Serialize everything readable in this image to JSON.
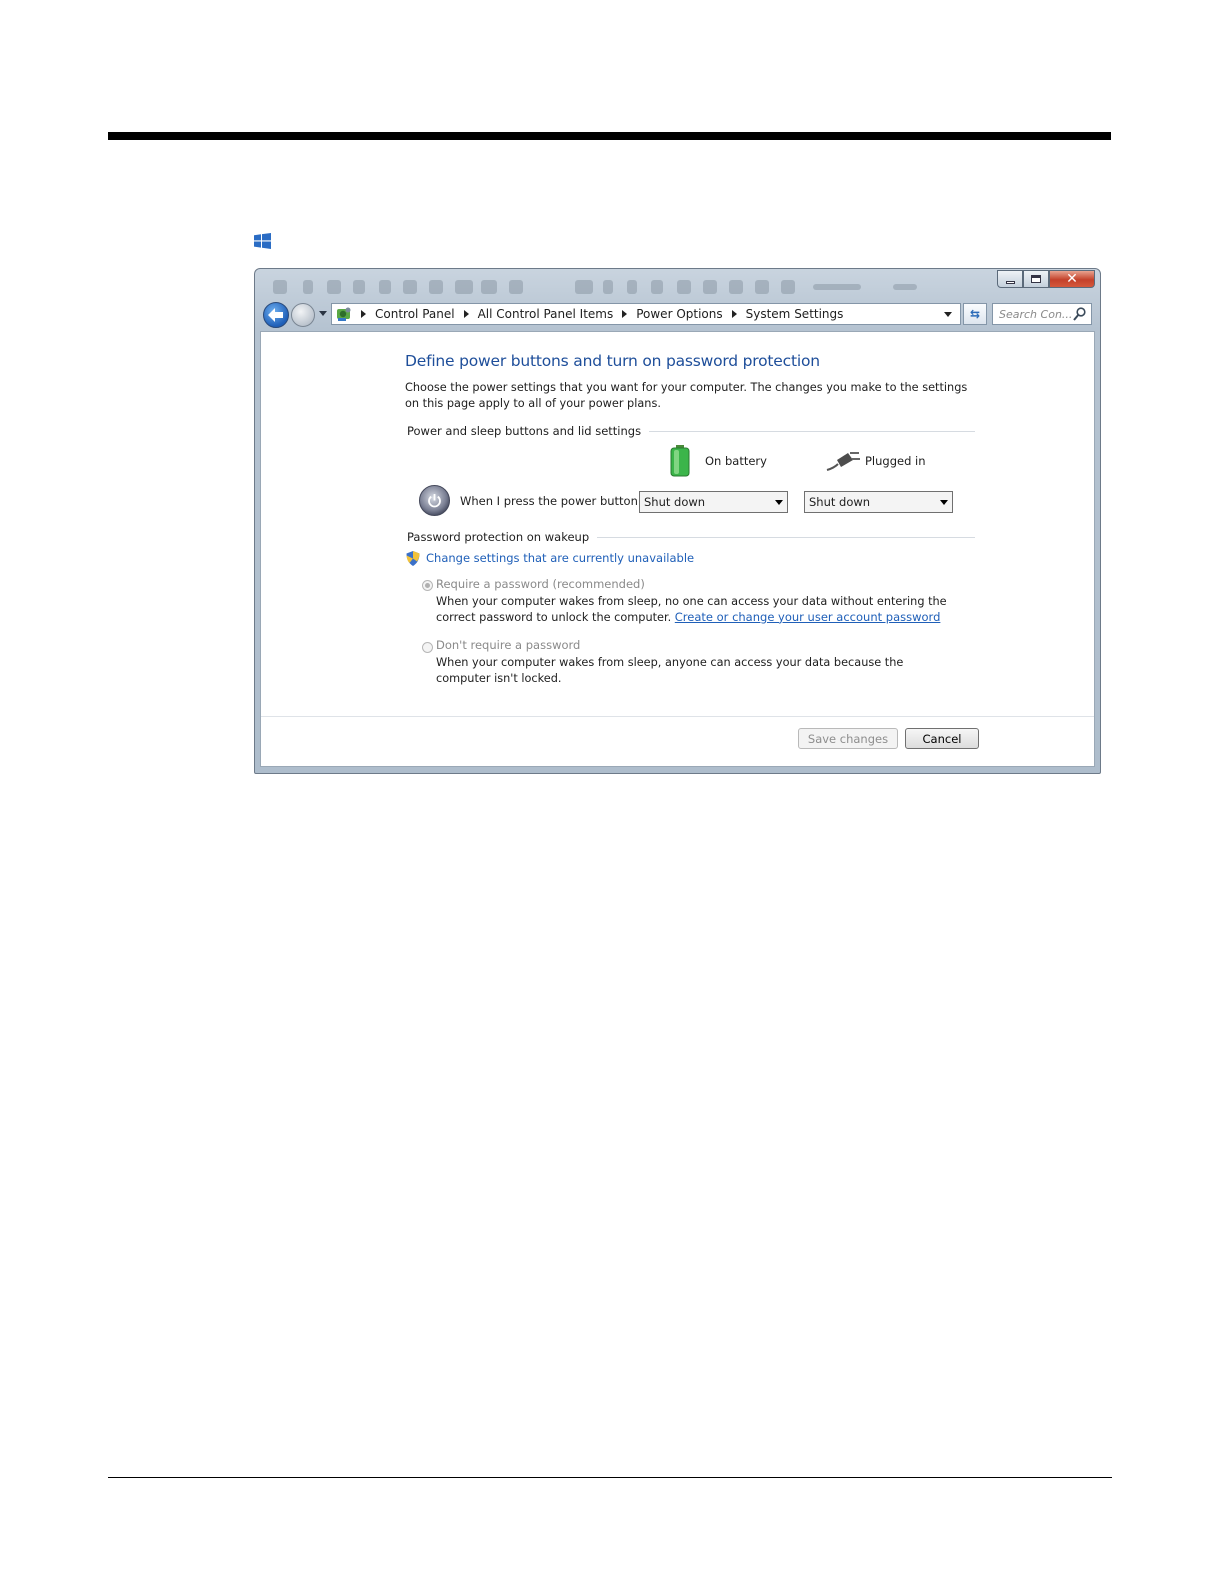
{
  "window": {
    "address": {
      "breadcrumbs": [
        "Control Panel",
        "All Control Panel Items",
        "Power Options",
        "System Settings"
      ]
    },
    "search": {
      "placeholder": "Search Con..."
    }
  },
  "page": {
    "title": "Define power buttons and turn on password protection",
    "description": "Choose the power settings that you want for your computer. The changes you make to the settings on this page apply to all of your power plans.",
    "buttons_section": {
      "heading": "Power and sleep buttons and lid settings",
      "on_battery_label": "On battery",
      "plugged_in_label": "Plugged in",
      "power_button_label": "When I press the power button:",
      "on_battery_value": "Shut down",
      "plugged_in_value": "Shut down"
    },
    "password_section": {
      "heading": "Password protection on wakeup",
      "change_link": "Change settings that are currently unavailable",
      "require": {
        "label": "Require a password (recommended)",
        "description": "When your computer wakes from sleep, no one can access your data without entering the correct password to unlock the computer.",
        "link": "Create or change your user account password"
      },
      "no_require": {
        "label": "Don't require a password",
        "description": "When your computer wakes from sleep, anyone can access your data because the computer isn't locked."
      }
    },
    "footer": {
      "save_label": "Save changes",
      "cancel_label": "Cancel"
    }
  },
  "colors": {
    "title_blue": "#1e4e9a",
    "link_blue": "#1f5fb8",
    "battery_green": "#3bb54a",
    "close_red": "#c4412a"
  },
  "icons": [
    "windows-logo-icon",
    "back-arrow-icon",
    "control-panel-icon",
    "refresh-icon",
    "search-icon",
    "battery-icon",
    "plug-icon",
    "power-icon",
    "shield-icon"
  ]
}
